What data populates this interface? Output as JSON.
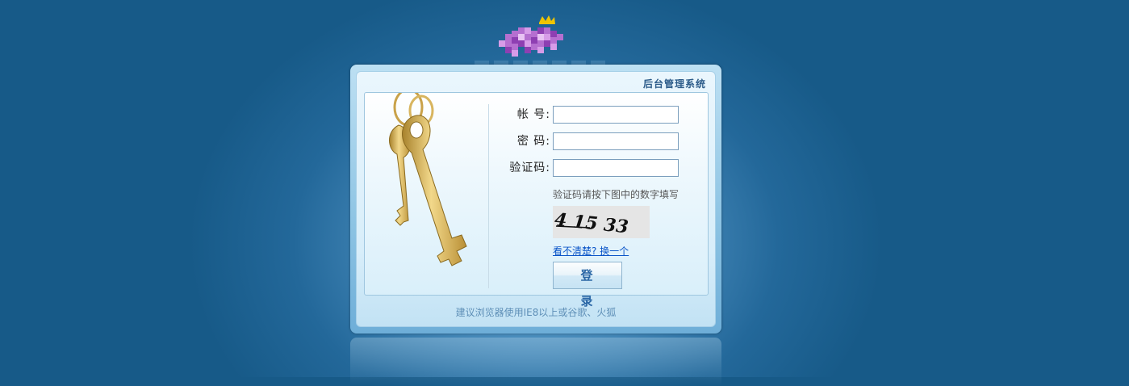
{
  "logo": {
    "icon": "crown-logo-icon"
  },
  "panel": {
    "title": "后台管理系统"
  },
  "form": {
    "account_label": "帐 号:",
    "account_value": "",
    "password_label": "密 码:",
    "password_value": "",
    "captcha_label": "验证码:",
    "captcha_value": "",
    "captcha_hint": "验证码请按下图中的数字填写",
    "captcha_text": "4 15 33",
    "refresh_link": "看不清楚? 换一个",
    "login_button": "登 录"
  },
  "footer": {
    "text": "建议浏览器使用IE8以上或谷歌、火狐"
  },
  "colors": {
    "background": "#175a88",
    "title": "#2d5c8a",
    "link": "#0b55c8"
  }
}
